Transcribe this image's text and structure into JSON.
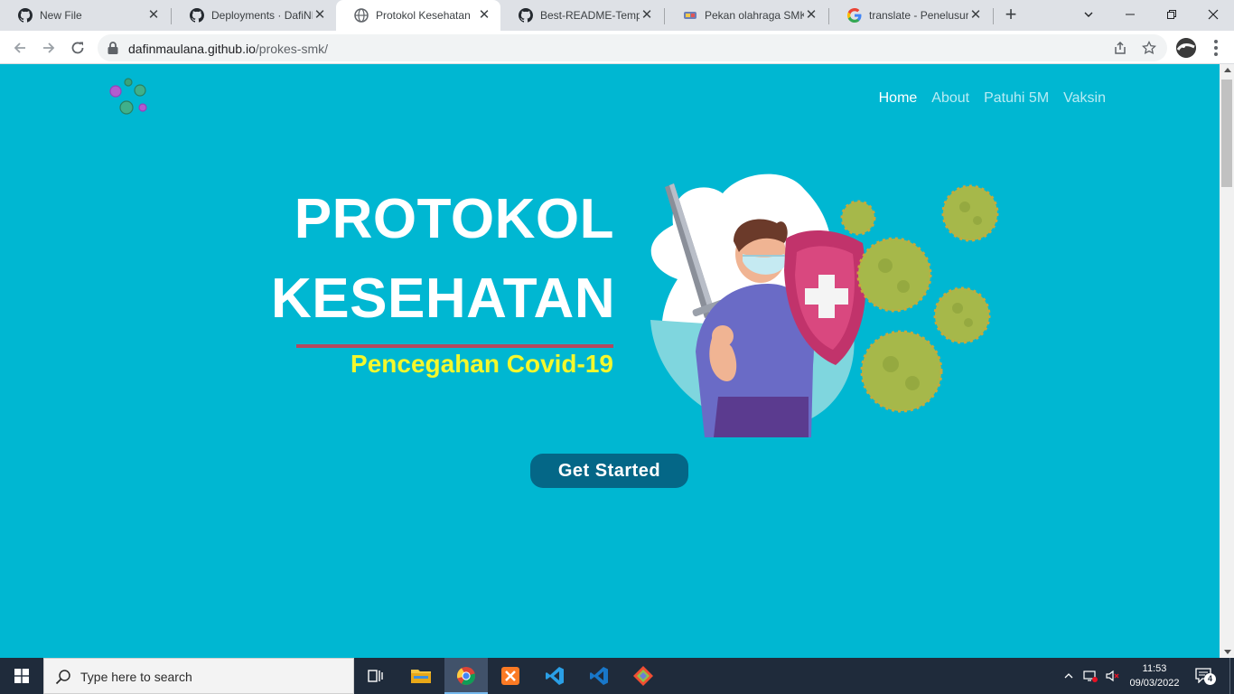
{
  "browser": {
    "tabs": [
      {
        "title": "New File",
        "icon": "github-icon",
        "active": false
      },
      {
        "title": "Deployments · DafiNM",
        "icon": "github-icon",
        "active": false
      },
      {
        "title": "Protokol Kesehatan",
        "icon": "globe-icon",
        "active": true
      },
      {
        "title": "Best-README-Templa",
        "icon": "github-icon",
        "active": false
      },
      {
        "title": "Pekan olahraga SMK N",
        "icon": "site-icon",
        "active": false
      },
      {
        "title": "translate - Penelusura",
        "icon": "google-icon",
        "active": false
      }
    ],
    "new_tab_label": "+",
    "close_glyph": "✕",
    "url_domain": "dafinmaulana.github.io",
    "url_path": "/prokes-smk/"
  },
  "site": {
    "nav": [
      {
        "label": "Home",
        "current": true
      },
      {
        "label": "About",
        "current": false
      },
      {
        "label": "Patuhi 5M",
        "current": false
      },
      {
        "label": "Vaksin",
        "current": false
      }
    ],
    "hero": {
      "title_line1": "PROTOKOL",
      "title_line2": "KESEHATAN",
      "subtitle": "Pencegahan Covid-19",
      "cta_label": "Get Started"
    },
    "colors": {
      "background": "#00b7d2",
      "subtitle": "#f4f82c",
      "accent_line": "#b5485f",
      "button": "#046787"
    }
  },
  "taskbar": {
    "search_placeholder": "Type here to search",
    "apps": [
      "task-view-icon",
      "file-explorer-icon",
      "chrome-icon",
      "xampp-icon",
      "vscode-icon",
      "vscode-insiders-icon",
      "git-icon"
    ],
    "time": "11:53",
    "date": "09/03/2022",
    "notification_count": "4"
  }
}
